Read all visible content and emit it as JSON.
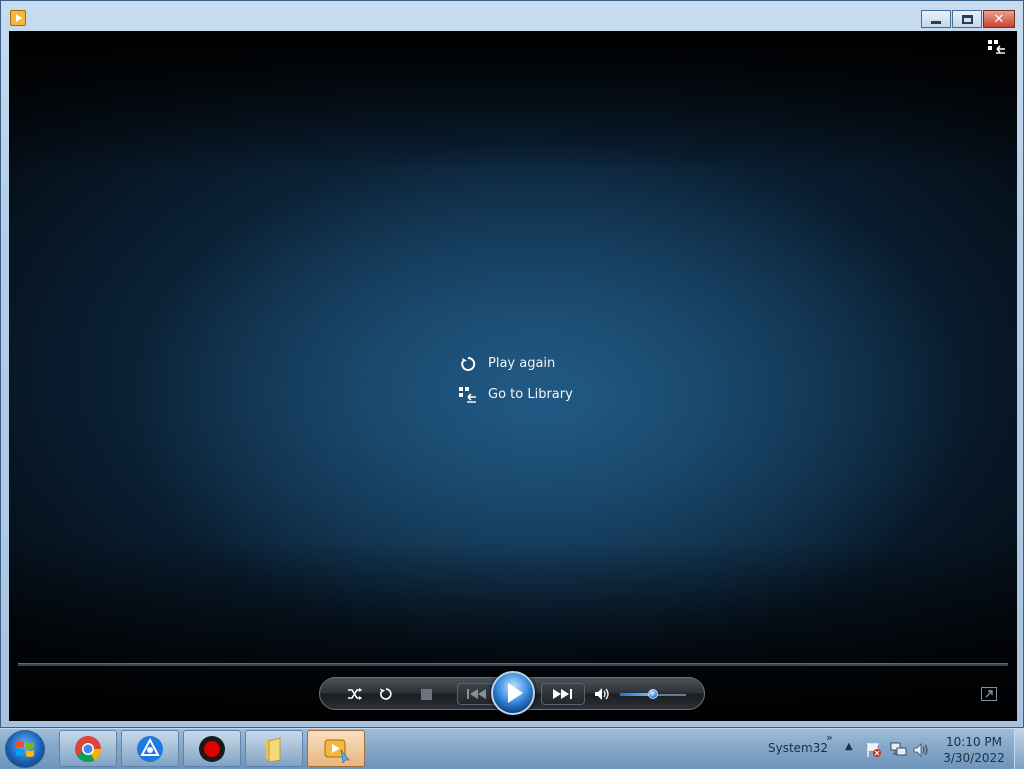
{
  "window": {
    "title": "",
    "buttons": {
      "minimize": "minimize",
      "maximize": "maximize",
      "close": "close"
    }
  },
  "menu": {
    "play_again": "Play again",
    "go_to_library": "Go to Library"
  },
  "controls": {
    "volume_level": 0.5,
    "icons": [
      "shuffle-icon",
      "repeat-icon",
      "stop-icon",
      "previous-icon",
      "play-icon",
      "next-icon",
      "volume-icon"
    ]
  },
  "taskbar": {
    "apps": [
      "chrome-icon",
      "blue-app-icon",
      "record-icon",
      "folder-icon",
      "media-player-icon"
    ],
    "toolbar_label": "System32",
    "time": "10:10 PM",
    "date": "3/30/2022"
  },
  "colors": {
    "accent": "#3b8ee0",
    "viewport_dark": "#03080e",
    "viewport_glow": "#235f8c"
  }
}
